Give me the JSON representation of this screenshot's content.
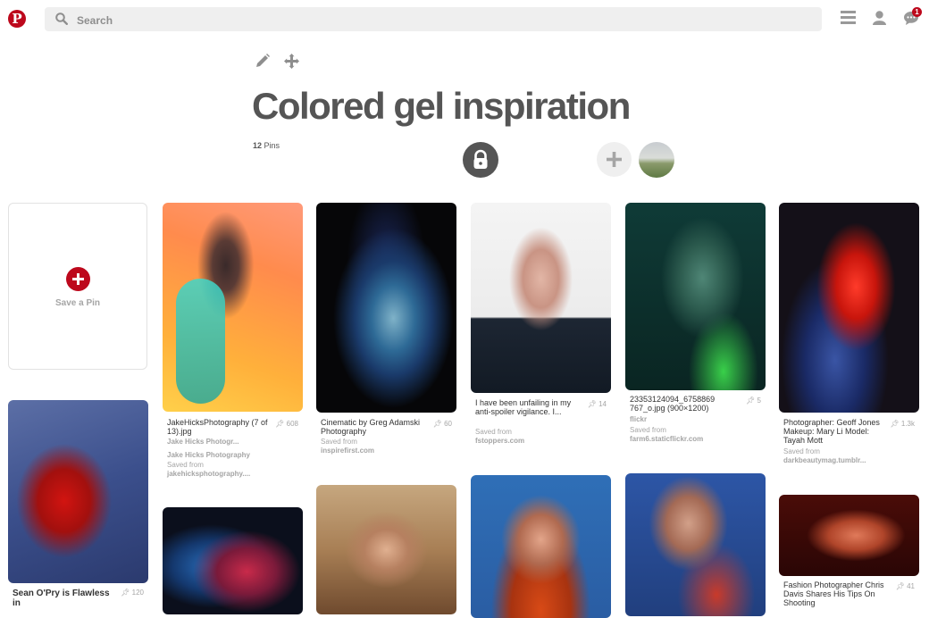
{
  "search": {
    "placeholder": "Search"
  },
  "notifications": {
    "badge": "1"
  },
  "board": {
    "title": "Colored gel inspiration",
    "pin_count": "12",
    "pin_count_label": "Pins"
  },
  "save_pin": {
    "label": "Save a Pin"
  },
  "pins": [
    {
      "desc": "Sean O'Pry is Flawless in",
      "saves": "120"
    },
    {
      "desc": "JakeHicksPhotography (7 of 13).jpg",
      "saves": "608",
      "pinner": "Jake Hicks Photogr...",
      "board": "Jake Hicks Photography",
      "saved_from_label": "Saved from",
      "source": "jakehicksphotography...."
    },
    {
      "desc": "Cinematic by Greg Adamski Photography",
      "saves": "60",
      "saved_from_label": "Saved from",
      "source": "inspirefirst.com"
    },
    {
      "desc": "I have been unfailing in my anti-spoiler vigilance. I...",
      "saves": "14",
      "saved_from_label": "Saved from",
      "source": "fstoppers.com"
    },
    {
      "desc": "23353124094_6758869 767_o.jpg (900×1200)",
      "saves": "5",
      "pinner": "flickr",
      "saved_from_label": "Saved from",
      "source": "farm6.staticflickr.com"
    },
    {
      "desc": "Photographer: Geoff Jones Makeup: Mary Li Model: Tayah Mott",
      "saves": "1.3k",
      "saved_from_label": "Saved from",
      "source": "darkbeautymag.tumblr..."
    },
    {
      "desc": "Fashion Photographer Chris Davis Shares His Tips On Shooting",
      "saves": "41"
    }
  ],
  "colors": {
    "brand": "#bd081c",
    "title": "#555555",
    "muted": "#a5a5a5"
  }
}
